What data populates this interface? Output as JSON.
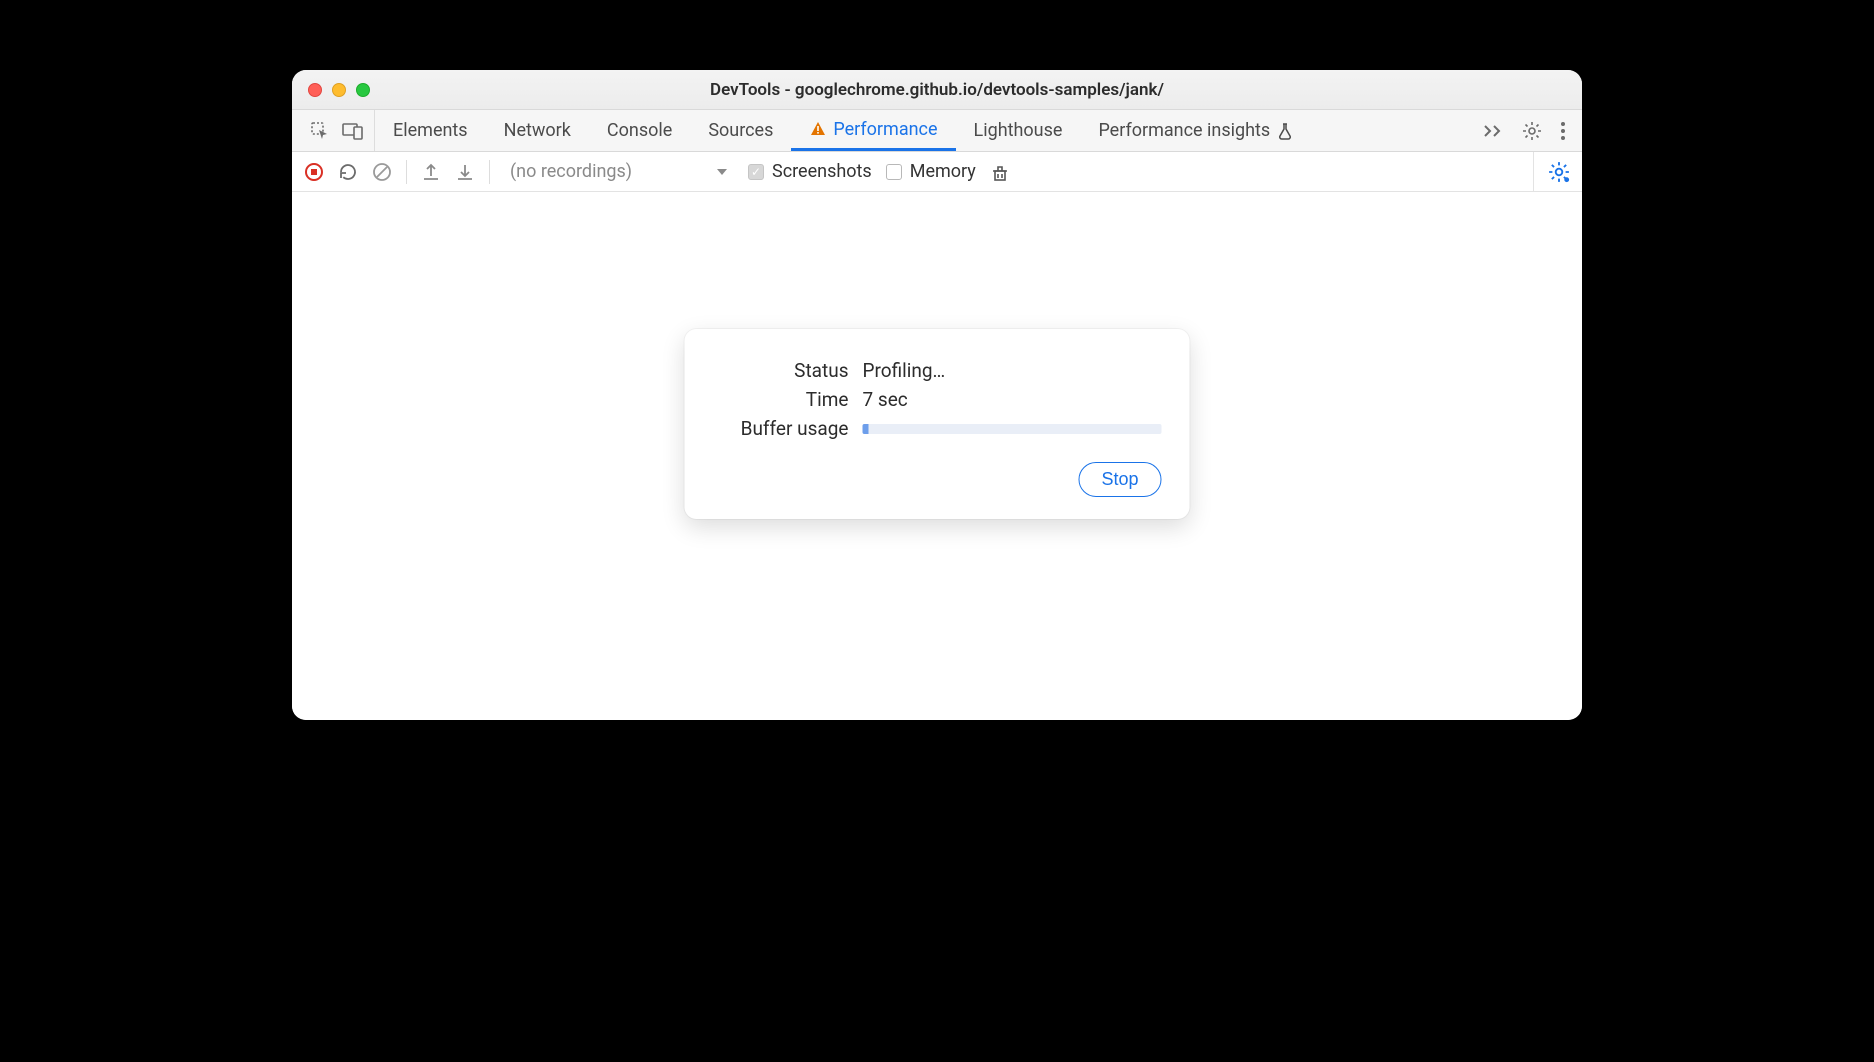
{
  "window": {
    "title": "DevTools - googlechrome.github.io/devtools-samples/jank/"
  },
  "tabs": {
    "elements": "Elements",
    "network": "Network",
    "console": "Console",
    "sources": "Sources",
    "performance": "Performance",
    "lighthouse": "Lighthouse",
    "performance_insights": "Performance insights"
  },
  "perfbar": {
    "recordings_label": "(no recordings)",
    "screenshots_label": "Screenshots",
    "memory_label": "Memory"
  },
  "dialog": {
    "status_label": "Status",
    "status_value": "Profiling…",
    "time_label": "Time",
    "time_value": "7 sec",
    "buffer_label": "Buffer usage",
    "buffer_percent": 2,
    "stop_label": "Stop"
  }
}
